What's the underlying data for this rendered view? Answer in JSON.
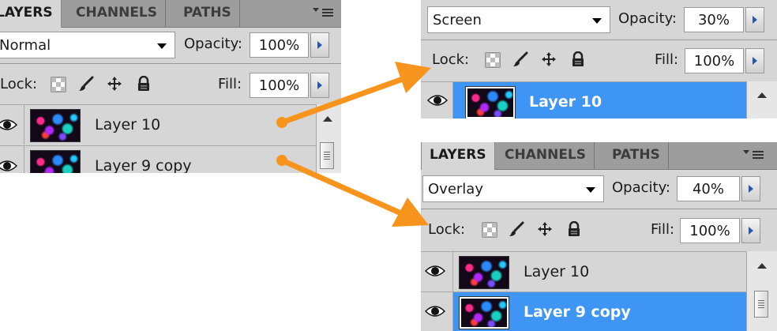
{
  "panels": {
    "left": {
      "tabs": [
        "LAYERS",
        "CHANNELS",
        "PATHS"
      ],
      "blend_mode": "Normal",
      "opacity_label": "Opacity:",
      "opacity": "100%",
      "lock_label": "Lock:",
      "fill_label": "Fill:",
      "fill": "100%",
      "layers": [
        {
          "name": "Layer 10",
          "selected": false
        },
        {
          "name": "Layer 9 copy",
          "selected": false
        }
      ]
    },
    "top_right": {
      "blend_mode": "Screen",
      "opacity_label": "Opacity:",
      "opacity": "30%",
      "lock_label": "Lock:",
      "fill_label": "Fill:",
      "fill": "100%",
      "layers": [
        {
          "name": "Layer 10",
          "selected": true
        }
      ]
    },
    "bottom_right": {
      "tabs": [
        "LAYERS",
        "CHANNELS",
        "PATHS"
      ],
      "blend_mode": "Overlay",
      "opacity_label": "Opacity:",
      "opacity": "40%",
      "lock_label": "Lock:",
      "fill_label": "Fill:",
      "fill": "100%",
      "layers": [
        {
          "name": "Layer 10",
          "selected": false
        },
        {
          "name": "Layer 9 copy",
          "selected": true
        }
      ]
    }
  },
  "icons": [
    "eye-icon",
    "lock-transparent-icon",
    "lock-brush-icon",
    "lock-move-icon",
    "lock-all-icon",
    "panel-menu-icon"
  ],
  "colors": {
    "arrow": "#f7941d",
    "selection": "#3f95f3",
    "panel_bg": "#d6d6d6",
    "tabbar": "#9d9d9d"
  }
}
